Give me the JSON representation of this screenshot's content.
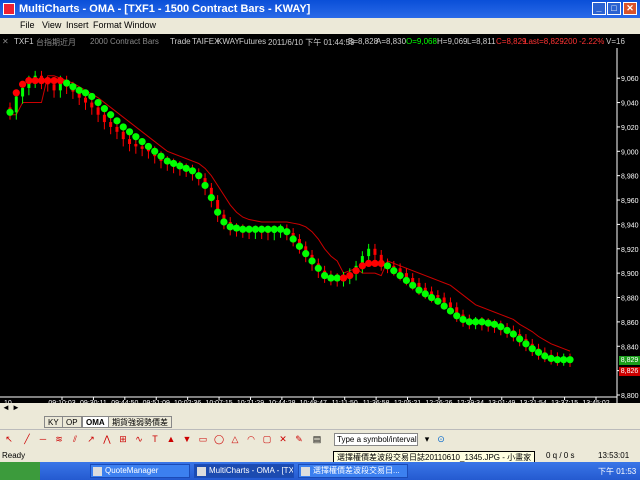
{
  "window": {
    "title": "MultiCharts - OMA - [TXF1 - 1500 Contract Bars - KWAY]",
    "controls": [
      "_",
      "□",
      "✕"
    ]
  },
  "menu": [
    "File",
    "View",
    "Insert",
    "Format",
    "Window"
  ],
  "infobar": {
    "symbol": "TXF1",
    "name": "台指期近月",
    "resolution": "2000 Contract Bars",
    "mode": "Trade",
    "exchange": "TAIFEX",
    "data_source": "KWAY",
    "category": "Futures",
    "datetime": "2011/6/10 下午 01:44:59",
    "bid": "B=8,828",
    "ask": "A=8,830",
    "open": "O=9,068",
    "high": "H=9,069",
    "low": "L=8,811",
    "close": "C=8,829",
    "last": "Last=8,829",
    "change": "-200",
    "change_pct": "-2.22%",
    "volume": "V=16"
  },
  "chart_data": {
    "type": "candlestick",
    "y_ticks": [
      "9,060",
      "9,040",
      "9,020",
      "9,000",
      "8,980",
      "8,960",
      "8,940",
      "8,920",
      "8,900",
      "8,880",
      "8,860",
      "8,840",
      "8,820",
      "8,800"
    ],
    "ylim": [
      8800,
      9070
    ],
    "x_ticks": [
      "09:10:03",
      "09:30:11",
      "09:44:50",
      "09:51:09",
      "10:02:36",
      "10:07:15",
      "10:21:29",
      "10:44:28",
      "10:48:47",
      "11:11:50",
      "11:36:58",
      "12:05:21",
      "12:26:26",
      "12:39:34",
      "13:01:49",
      "13:21:54",
      "13:37:15",
      "13:45:02"
    ],
    "x_left_label": "10",
    "last_price_tag": "8,829",
    "close_tag": "8,826",
    "colors": {
      "up": "#00ff00",
      "down": "#ff0000",
      "trail": "#cc0000",
      "trail_alt": "#33aa33",
      "axis": "#ffffff"
    },
    "closes": [
      9032,
      9045,
      9052,
      9058,
      9062,
      9057,
      9055,
      9050,
      9058,
      9053,
      9049,
      9044,
      9040,
      9036,
      9030,
      9024,
      9020,
      9016,
      9010,
      9006,
      9004,
      9002,
      9000,
      8996,
      8992,
      8990,
      8988,
      8986,
      8985,
      8982,
      8978,
      8970,
      8960,
      8948,
      8942,
      8937,
      8936,
      8935,
      8934,
      8935,
      8934,
      8933,
      8935,
      8936,
      8933,
      8928,
      8922,
      8915,
      8908,
      8902,
      8898,
      8896,
      8895,
      8897,
      8900,
      8906,
      8914,
      8920,
      8915,
      8908,
      8906,
      8904,
      8900,
      8896,
      8892,
      8888,
      8885,
      8882,
      8880,
      8876,
      8872,
      8866,
      8862,
      8860,
      8860,
      8859,
      8858,
      8857,
      8855,
      8853,
      8850,
      8846,
      8842,
      8838,
      8835,
      8833,
      8831,
      8830,
      8830,
      8829
    ],
    "dots": [
      9032,
      9048,
      9055,
      9058,
      9058,
      9058,
      9058,
      9058,
      9058,
      9056,
      9053,
      9050,
      9048,
      9045,
      9040,
      9035,
      9030,
      9025,
      9020,
      9016,
      9012,
      9008,
      9004,
      9000,
      8996,
      8992,
      8990,
      8988,
      8986,
      8984,
      8980,
      8972,
      8962,
      8950,
      8942,
      8938,
      8937,
      8936,
      8936,
      8936,
      8936,
      8936,
      8936,
      8936,
      8934,
      8928,
      8922,
      8916,
      8910,
      8904,
      8898,
      8896,
      8896,
      8896,
      8898,
      8902,
      8906,
      8908,
      8908,
      8908,
      8906,
      8902,
      8898,
      8894,
      8890,
      8886,
      8883,
      8880,
      8877,
      8873,
      8869,
      8865,
      8862,
      8860,
      8860,
      8860,
      8859,
      8858,
      8856,
      8853,
      8850,
      8846,
      8842,
      8838,
      8835,
      8832,
      8830,
      8829,
      8829,
      8829
    ],
    "dot_colors": [
      "up",
      "down",
      "down",
      "down",
      "down",
      "down",
      "down",
      "down",
      "down",
      "up",
      "up",
      "up",
      "up",
      "up",
      "up",
      "up",
      "up",
      "up",
      "up",
      "up",
      "up",
      "up",
      "up",
      "up",
      "up",
      "up",
      "up",
      "up",
      "up",
      "up",
      "up",
      "up",
      "up",
      "up",
      "up",
      "up",
      "up",
      "up",
      "up",
      "up",
      "up",
      "up",
      "up",
      "up",
      "up",
      "up",
      "up",
      "up",
      "up",
      "up",
      "up",
      "up",
      "up",
      "down",
      "down",
      "down",
      "down",
      "down",
      "down",
      "down",
      "up",
      "up",
      "up",
      "up",
      "up",
      "up",
      "up",
      "up",
      "up",
      "up",
      "up",
      "up",
      "up",
      "up",
      "up",
      "up",
      "up",
      "up",
      "up",
      "up",
      "up",
      "up",
      "up",
      "up",
      "up",
      "up",
      "up",
      "up",
      "up",
      "up"
    ],
    "trail": [
      9030,
      9030,
      9040,
      9040,
      9040,
      9040,
      9062,
      9062,
      9060,
      9058,
      9056,
      9053,
      9050,
      9047,
      9044,
      9040,
      9036,
      9032,
      9028,
      9024,
      9020,
      9016,
      9012,
      9008,
      9004,
      9000,
      8998,
      8996,
      8994,
      8992,
      8990,
      8986,
      8980,
      8972,
      8964,
      8956,
      8950,
      8946,
      8944,
      8943,
      8942,
      8942,
      8942,
      8942,
      8942,
      8941,
      8940,
      8938,
      8934,
      8928,
      8920,
      8914,
      8910,
      8900,
      8902,
      8904,
      8900,
      8900,
      8900,
      8898,
      8910,
      8908,
      8906,
      8904,
      8902,
      8900,
      8898,
      8896,
      8894,
      8892,
      8890,
      8886,
      8882,
      8878,
      8874,
      8872,
      8870,
      8868,
      8866,
      8864,
      8862,
      8858,
      8855,
      8852,
      8848,
      8845,
      8842,
      8840,
      8838,
      8836
    ]
  },
  "tabs": [
    "KY",
    "OP",
    "OMA",
    "期貨強弱勢價差"
  ],
  "toolbar": {
    "symbol_placeholder": "Type a symbol/interval"
  },
  "status": {
    "text": "Ready",
    "quotes": "0 q / 0 s",
    "clock": "13:53:01"
  },
  "tooltip": "選擇權價差波段交易日誌20110610_1345.JPG - 小畫家",
  "taskbar": {
    "tasks": [
      "QuoteManager",
      "MultiCharts - OMA - [TX...",
      "選擇權價差波段交易日..."
    ],
    "clock": "下午 01:53"
  }
}
